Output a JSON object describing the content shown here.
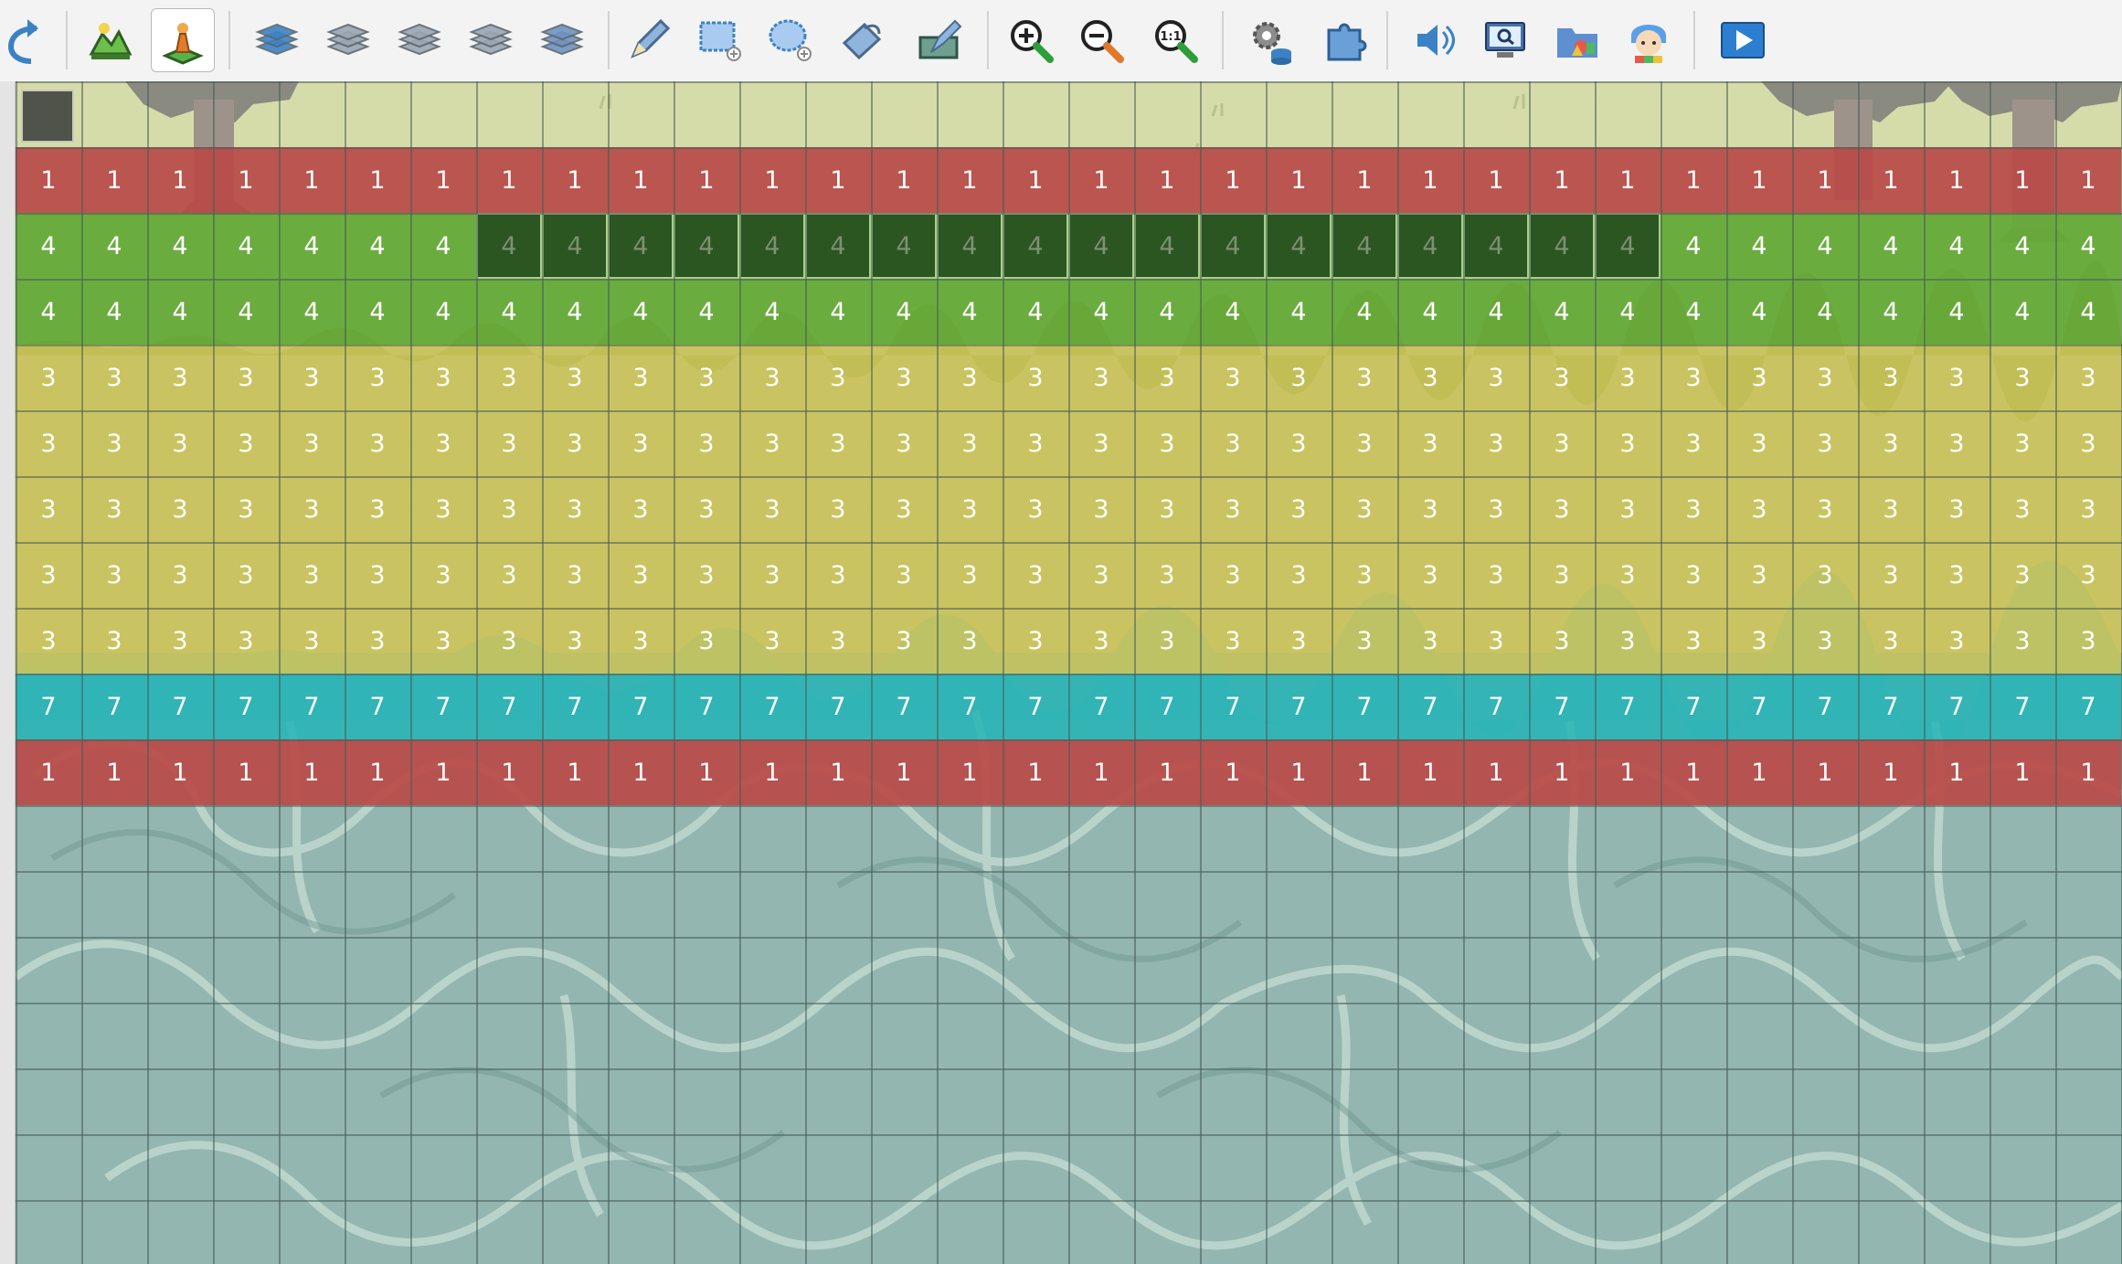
{
  "toolbar": {
    "buttons": [
      {
        "name": "undo-button",
        "icon": "undo-arrow-icon"
      },
      {
        "name": "map-mode-button",
        "icon": "map-landscape-icon"
      },
      {
        "name": "event-mode-button",
        "icon": "event-pawn-icon",
        "selected": true
      },
      {
        "name": "layer-1-button",
        "icon": "layer-stack-1-icon"
      },
      {
        "name": "layer-2-button",
        "icon": "layer-stack-2-icon"
      },
      {
        "name": "layer-3-button",
        "icon": "layer-stack-3-icon"
      },
      {
        "name": "layer-4-button",
        "icon": "layer-stack-4-icon"
      },
      {
        "name": "layer-all-button",
        "icon": "layer-stack-all-icon"
      },
      {
        "name": "pencil-tool-button",
        "icon": "pencil-icon"
      },
      {
        "name": "rectangle-tool-button",
        "icon": "rectangle-select-icon"
      },
      {
        "name": "ellipse-tool-button",
        "icon": "ellipse-select-icon"
      },
      {
        "name": "fill-tool-button",
        "icon": "fill-bucket-icon"
      },
      {
        "name": "shadow-pen-button",
        "icon": "shadow-pen-icon"
      },
      {
        "name": "zoom-in-button",
        "icon": "zoom-in-icon"
      },
      {
        "name": "zoom-out-button",
        "icon": "zoom-out-icon"
      },
      {
        "name": "zoom-actual-button",
        "icon": "zoom-1-1-icon",
        "text": "1:1"
      },
      {
        "name": "database-button",
        "icon": "gear-database-icon"
      },
      {
        "name": "plugin-manager-button",
        "icon": "puzzle-piece-icon"
      },
      {
        "name": "sound-test-button",
        "icon": "speaker-icon"
      },
      {
        "name": "event-searcher-button",
        "icon": "monitor-search-icon"
      },
      {
        "name": "resource-manager-button",
        "icon": "folder-shapes-icon"
      },
      {
        "name": "character-generator-button",
        "icon": "character-face-icon"
      },
      {
        "name": "playtest-button",
        "icon": "play-icon"
      }
    ]
  },
  "colors": {
    "region_1": "#b94a48",
    "region_4": "#65a939",
    "region_3": "#c6c359",
    "region_7": "#20b3b4",
    "selected_tile": "#2b5521",
    "water": "#93b6b0",
    "grass": "#d5dcaa"
  },
  "map": {
    "columns": 32,
    "region_rows": [
      {
        "row": 1,
        "region": "1",
        "label": "1"
      },
      {
        "row": 2,
        "region": "4",
        "label": "4"
      },
      {
        "row": 3,
        "region": "4",
        "label": "4"
      },
      {
        "row": 4,
        "region": "3",
        "label": "3"
      },
      {
        "row": 5,
        "region": "3",
        "label": "3"
      },
      {
        "row": 6,
        "region": "3",
        "label": "3"
      },
      {
        "row": 7,
        "region": "3",
        "label": "3"
      },
      {
        "row": 8,
        "region": "3",
        "label": "3"
      },
      {
        "row": 9,
        "region": "7",
        "label": "7"
      },
      {
        "row": 10,
        "region": "1",
        "label": "1"
      }
    ],
    "selection": {
      "row": 2,
      "first_column": 7,
      "last_column": 24
    }
  }
}
